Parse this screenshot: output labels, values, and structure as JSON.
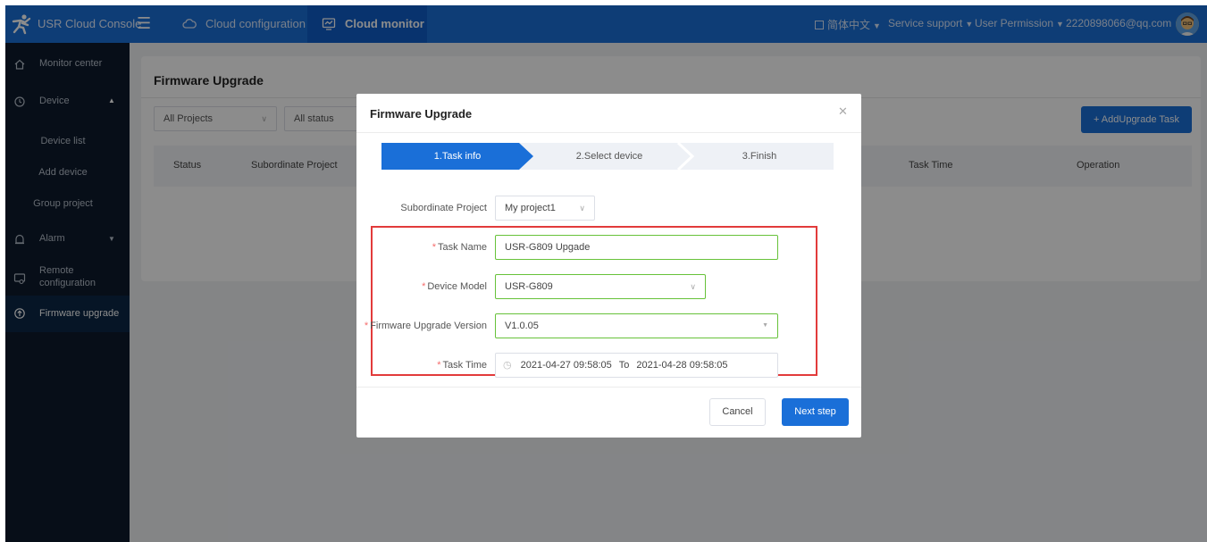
{
  "topbar": {
    "brand": "USR Cloud Console",
    "nav": [
      {
        "label": "Cloud configuration",
        "icon": "cloud-icon"
      },
      {
        "label": "Cloud monitor",
        "icon": "monitor-icon"
      }
    ],
    "language": "简体中文",
    "service_support": "Service support",
    "user_permission": "User Permission",
    "account": "2220898066@qq.com"
  },
  "sidebar": {
    "items": [
      {
        "label": "Monitor center",
        "icon": "home-icon"
      },
      {
        "label": "Device",
        "icon": "device-icon"
      },
      {
        "label": "Device list"
      },
      {
        "label": "Add device"
      },
      {
        "label": "Group project"
      },
      {
        "label": "Alarm",
        "icon": "alarm-icon"
      },
      {
        "label": "Remote",
        "label2": "configuration",
        "icon": "remote-config-icon"
      },
      {
        "label": "Firmware upgrade",
        "icon": "upload-icon"
      }
    ]
  },
  "page": {
    "title": "Firmware Upgrade",
    "filters": {
      "project": "All Projects",
      "status": "All status"
    },
    "add_task_button": "+ AddUpgrade Task",
    "table_headers": [
      "Status",
      "Subordinate Project",
      "Task Time",
      "Operation"
    ]
  },
  "modal": {
    "title": "Firmware Upgrade",
    "steps": [
      "1.Task info",
      "2.Select device",
      "3.Finish"
    ],
    "active_step": 1,
    "fields": {
      "subordinate_project": {
        "label": "Subordinate Project",
        "value": "My project1"
      },
      "task_name": {
        "label": "Task Name",
        "value": "USR-G809 Upgade"
      },
      "device_model": {
        "label": "Device Model",
        "value": "USR-G809"
      },
      "firmware_version": {
        "label": "Firmware Upgrade Version",
        "value": "V1.0.05"
      },
      "task_time": {
        "label": "Task Time",
        "start": "2021-04-27 09:58:05",
        "separator": "To",
        "end": "2021-04-28 09:58:05"
      }
    },
    "cancel_button": "Cancel",
    "next_button": "Next step"
  },
  "colors": {
    "primary": "#1a6fd8",
    "sidebar_bg": "#0e1b2c",
    "required": "#f56c6c",
    "valid_border": "#67c23a",
    "highlight_box": "#e23b3b"
  }
}
